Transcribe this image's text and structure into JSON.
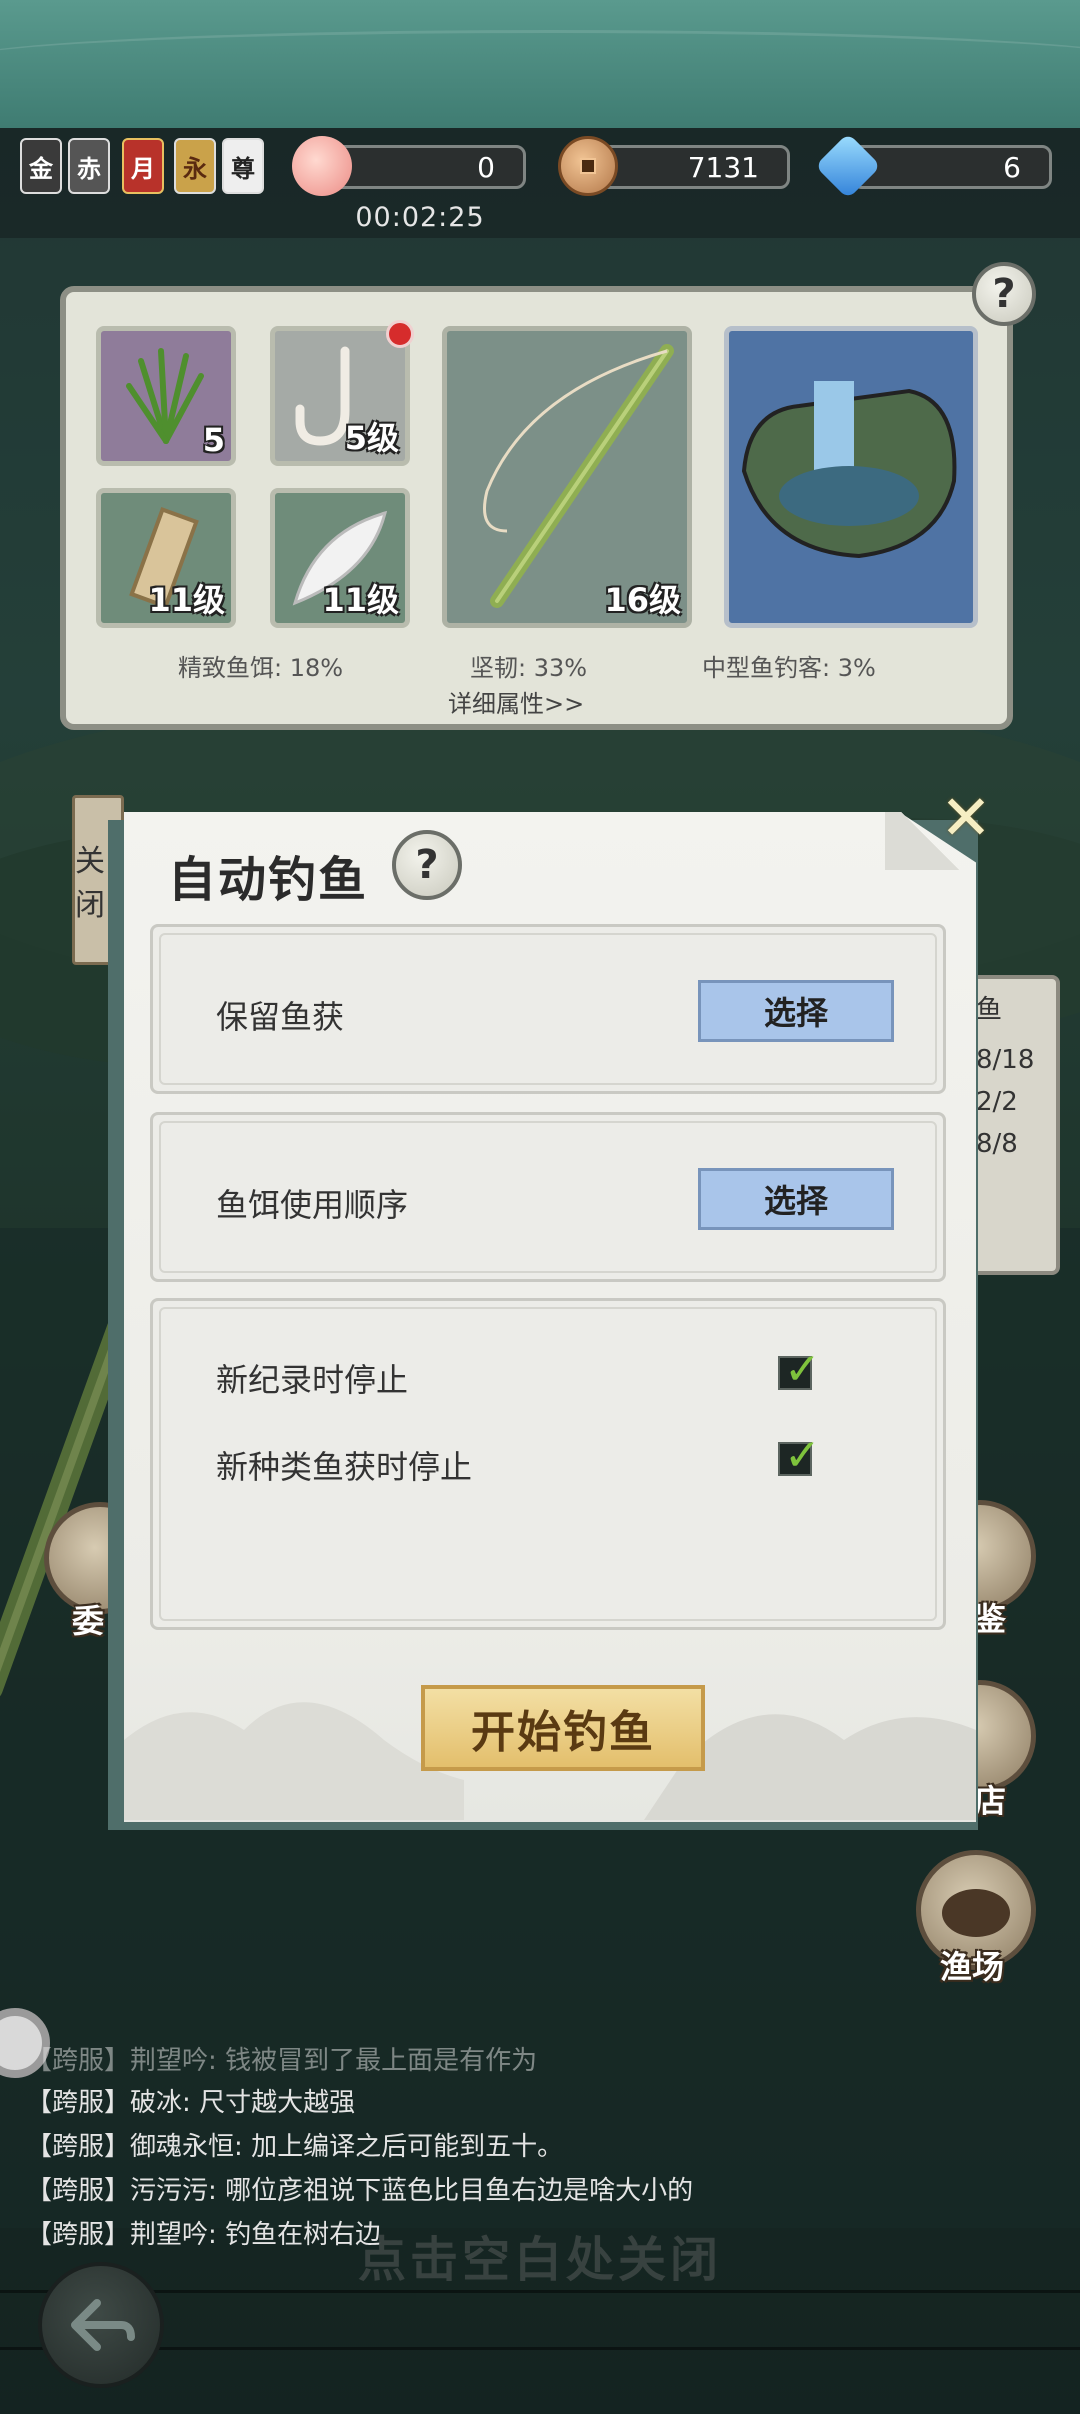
{
  "top_bar": {
    "badges": [
      "金",
      "赤",
      "月",
      "永",
      "尊"
    ],
    "resources": [
      {
        "icon": "peach-icon",
        "value": "0"
      },
      {
        "icon": "copper-coin-icon",
        "value": "7131"
      },
      {
        "icon": "blue-gem-icon",
        "value": "6"
      }
    ],
    "timer": "00:02:25"
  },
  "equipment": {
    "slots": [
      {
        "name": "bait",
        "level": "5"
      },
      {
        "name": "hook",
        "level": "5级"
      },
      {
        "name": "float",
        "level": "11级"
      },
      {
        "name": "feather",
        "level": "11级"
      },
      {
        "name": "rod",
        "level": "16级"
      },
      {
        "name": "fishing-spot",
        "level": ""
      }
    ],
    "stats": {
      "bait": "精致鱼饵: 18%",
      "rod": "坚韧: 33%",
      "spot": "中型鱼钓客: 3%"
    },
    "details_link": "详细属性>>"
  },
  "side_buttons": {
    "left_tag": "关闭",
    "left_round": "委",
    "right_1": "鉴",
    "right_2": "店",
    "right_3": "渔场"
  },
  "tally": [
    "鱼",
    "8/18",
    "2/2",
    "8/8"
  ],
  "modal": {
    "title": "自动钓鱼",
    "help": "?",
    "keep_catch_label": "保留鱼获",
    "keep_catch_button": "选择",
    "bait_order_label": "鱼饵使用顺序",
    "bait_order_button": "选择",
    "options": [
      {
        "label": "新纪录时停止",
        "checked": true
      },
      {
        "label": "新种类鱼获时停止",
        "checked": true
      }
    ],
    "start_button": "开始钓鱼"
  },
  "chat": [
    {
      "channel": "【跨服】",
      "user": "荆望吟",
      "text": "钱被冒到了最上面是有作为"
    },
    {
      "channel": "【跨服】",
      "user": "破冰",
      "text": "尺寸越大越强"
    },
    {
      "channel": "【跨服】",
      "user": "御魂永恒",
      "text": "加上编译之后可能到五十。"
    },
    {
      "channel": "【跨服】",
      "user": "污污污",
      "text": "哪位彦祖说下蓝色比目鱼右边是啥大小的"
    },
    {
      "channel": "【跨服】",
      "user": "荆望吟",
      "text": "钓鱼在树右边"
    }
  ],
  "tap_to_close": "点击空白处关闭",
  "colors": {
    "select_button": "#a9c5ea",
    "start_button": "#e3bf6c",
    "checkmark": "#7ec23c"
  }
}
